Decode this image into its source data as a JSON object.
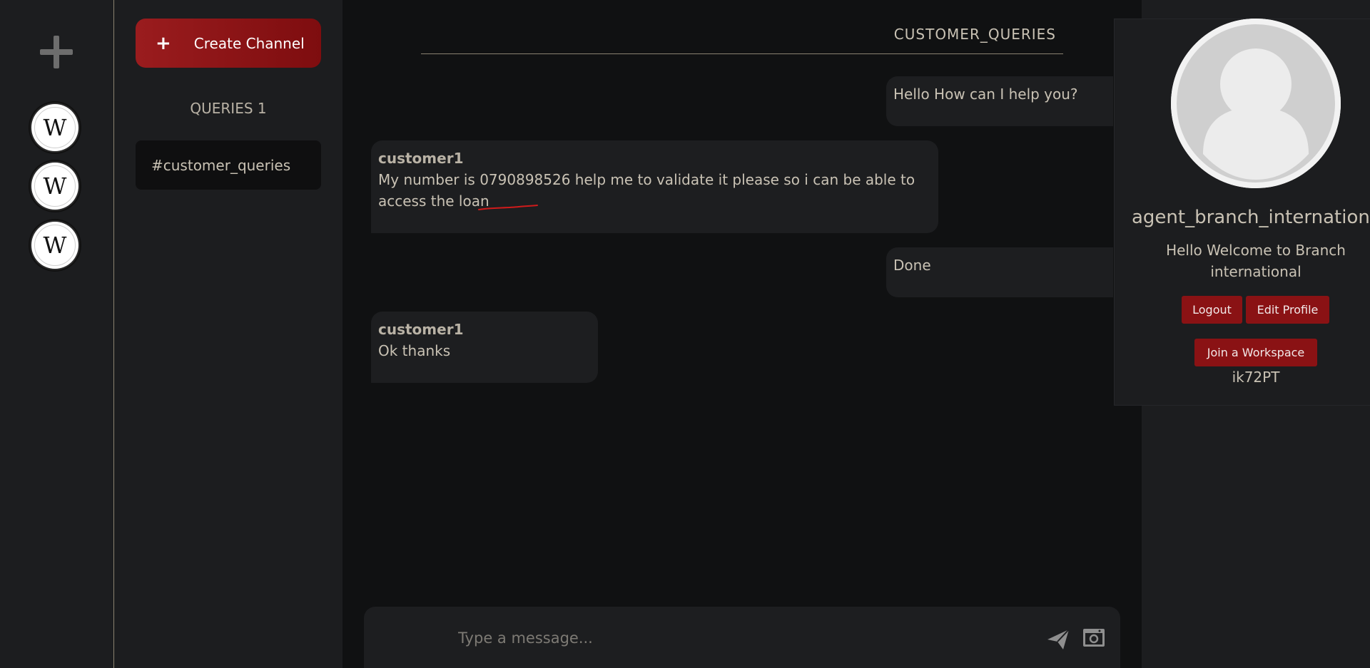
{
  "workspaces": {
    "add_icon": "plus-icon",
    "items": [
      {
        "letter": "W"
      },
      {
        "letter": "W"
      },
      {
        "letter": "W"
      }
    ]
  },
  "channels": {
    "create_label": "Create Channel",
    "create_icon": "+",
    "category_title": "QUERIES 1",
    "items": [
      {
        "label": "#customer_queries"
      }
    ]
  },
  "chat": {
    "channel_title": "CUSTOMER_QUERIES",
    "messages": [
      {
        "own": true,
        "text": "Hello How can I help you?"
      },
      {
        "own": false,
        "author": "customer1",
        "text": "My number is 0790898526 help me to validate it please so i can be able to access the loan"
      },
      {
        "own": true,
        "text": "Done"
      },
      {
        "own": false,
        "author": "customer1",
        "text": "Ok thanks"
      }
    ],
    "composer": {
      "placeholder": "Type a message...",
      "send_icon": "send-icon",
      "camera_icon": "camera-icon"
    }
  },
  "profile": {
    "name": "agent_branch_international",
    "bio": "Hello Welcome to Branch international",
    "logout_label": "Logout",
    "edit_label": "Edit Profile",
    "join_label": "Join a Workspace",
    "workspace_code": "ik72PT"
  },
  "colors": {
    "accent": "#8a1214",
    "background": "#101112",
    "panel": "#1c1d1f"
  }
}
